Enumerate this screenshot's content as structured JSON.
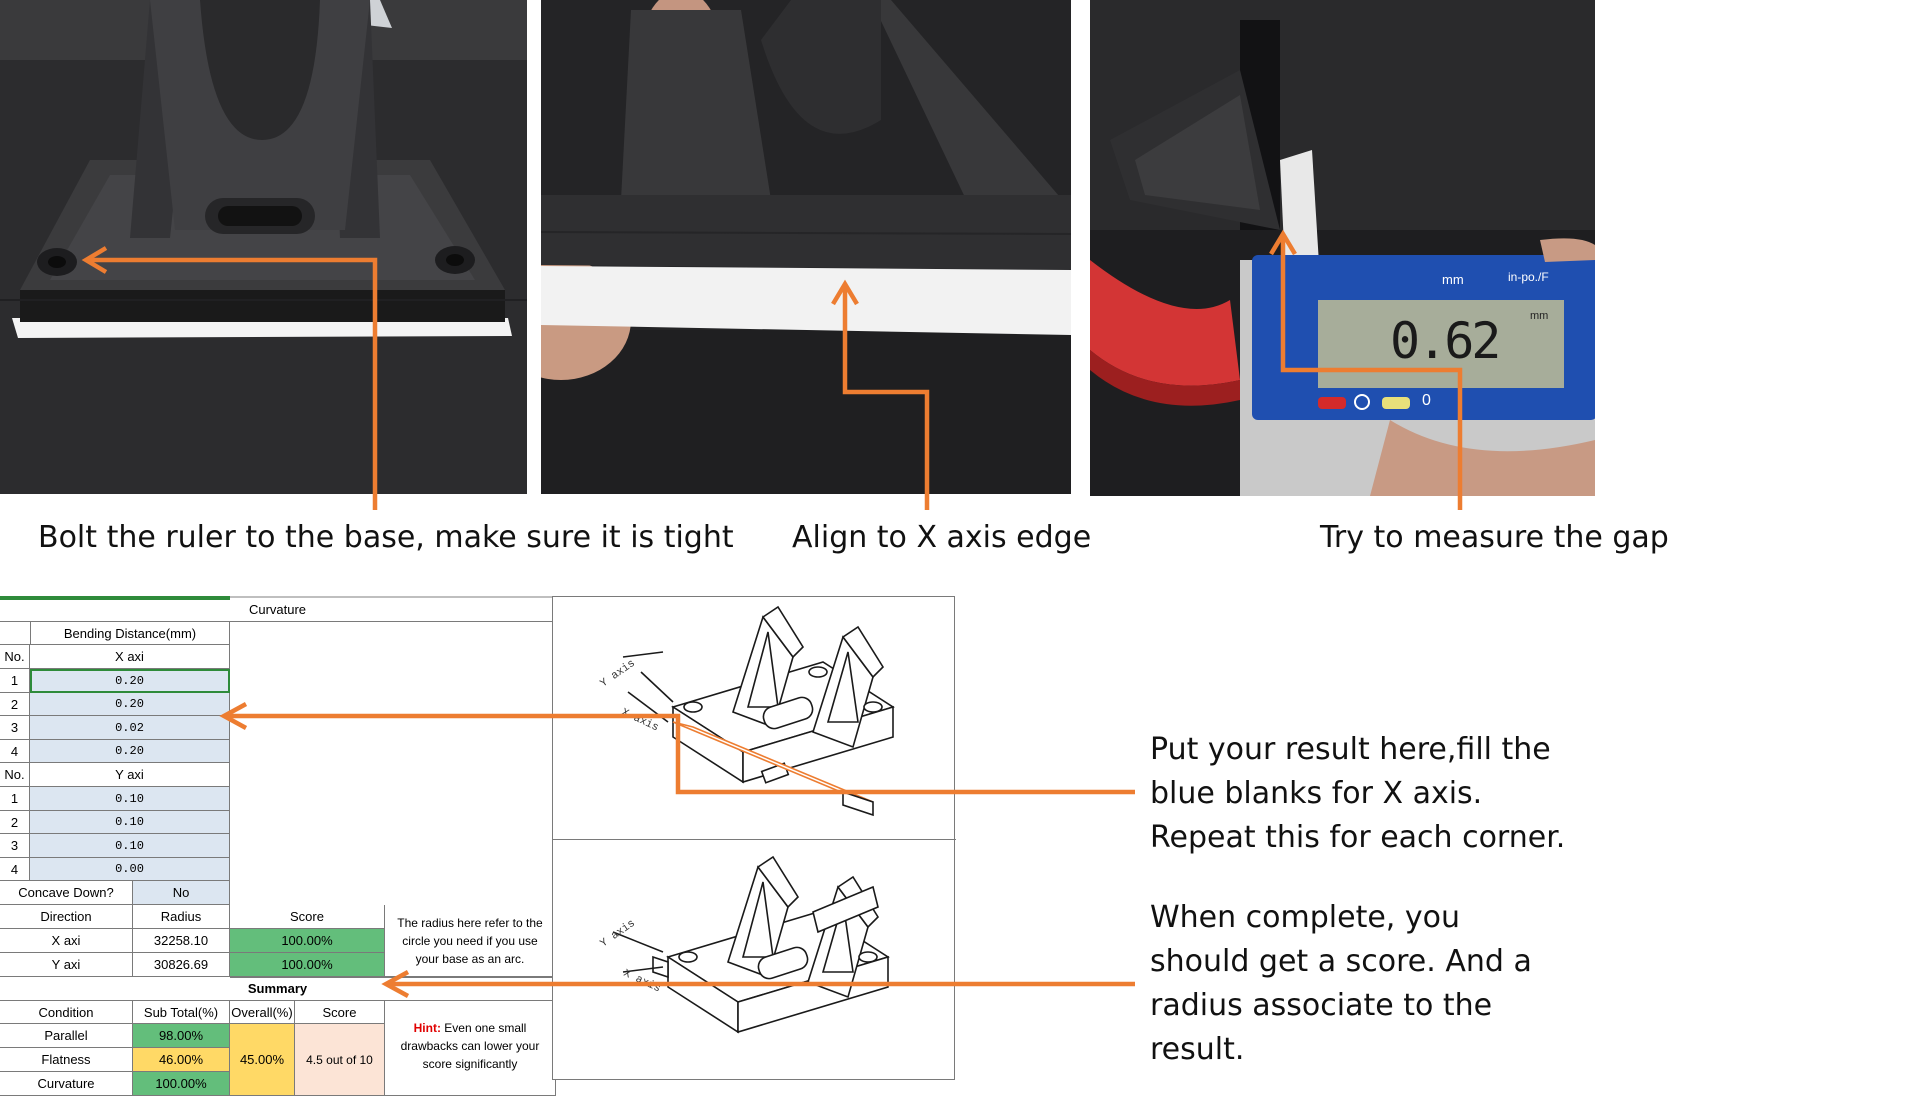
{
  "captions": {
    "bolt": "Bolt the ruler to the base, make sure it is tight",
    "align": "Align to X axis edge",
    "measure": "Try to measure the gap"
  },
  "caliper": {
    "reading": "0.62",
    "unit_top": "mm",
    "unit_right": "in-po./F",
    "unit_display": "mm",
    "zero_button": "0"
  },
  "notes": {
    "result_lines": [
      "Put your result here,fill the",
      "blue blanks for X axis.",
      "Repeat this for each corner."
    ],
    "complete_lines": [
      "When complete, you",
      "should get a score. And a",
      "radius associate to the",
      "result."
    ]
  },
  "drawing_labels": {
    "y_axis_top": "Y axis",
    "x_axis_top": "X axis",
    "y_axis_bottom": "Y axis",
    "x_axis_bottom": "X axis"
  },
  "sheet": {
    "curvature_header": "Curvature",
    "bending_header": "Bending Distance(mm)",
    "no_label": "No.",
    "x_axi_label": "X axi",
    "y_axi_label": "Y axi",
    "x_rows": [
      {
        "no": "1",
        "value": "0.20"
      },
      {
        "no": "2",
        "value": "0.20"
      },
      {
        "no": "3",
        "value": "0.02"
      },
      {
        "no": "4",
        "value": "0.20"
      }
    ],
    "y_rows": [
      {
        "no": "1",
        "value": "0.10"
      },
      {
        "no": "2",
        "value": "0.10"
      },
      {
        "no": "3",
        "value": "0.10"
      },
      {
        "no": "4",
        "value": "0.00"
      }
    ],
    "concave_label": "Concave Down?",
    "concave_value": "No",
    "direction_label": "Direction",
    "radius_label": "Radius",
    "score_label": "Score",
    "x_axi_row": {
      "direction": "X axi",
      "radius": "32258.10",
      "score": "100.00%"
    },
    "y_axi_row": {
      "direction": "Y axi",
      "radius": "30826.69",
      "score": "100.00%"
    },
    "radius_note": "The radius here refer to the circle you need if you use your base as an arc.",
    "summary_label": "Summary",
    "condition_label": "Condition",
    "subtotal_label": "Sub Total(%)",
    "overall_label": "Overall(%)",
    "score2_label": "Score",
    "conditions": [
      {
        "name": "Parallel",
        "subtotal": "98.00%"
      },
      {
        "name": "Flatness",
        "subtotal": "46.00%"
      },
      {
        "name": "Curvature",
        "subtotal": "100.00%"
      }
    ],
    "overall_value": "45.00%",
    "score_value": "4.5 out of 10",
    "hint_label": "Hint:",
    "hint_text": " Even one small drawbacks can lower your score significantly"
  },
  "colors": {
    "arrow": "#ed7d31",
    "cell_blue": "#dce6f1",
    "cell_green": "#63be7b",
    "cell_yellow": "#ffd966",
    "cell_peach": "#fce4d6",
    "hint_red": "#e00000"
  }
}
